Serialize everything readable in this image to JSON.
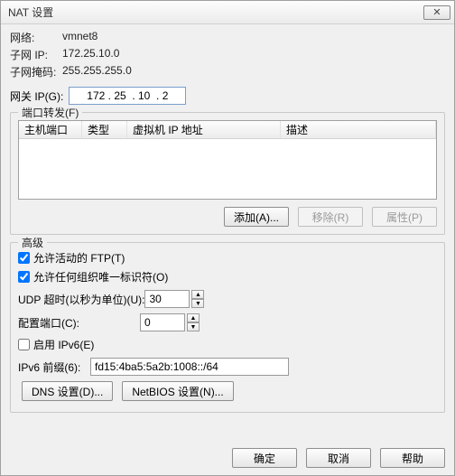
{
  "title": "NAT 设置",
  "info": {
    "network_label": "网络:",
    "network_value": "vmnet8",
    "subnet_ip_label": "子网 IP:",
    "subnet_ip_value": "172.25.10.0",
    "subnet_mask_label": "子网掩码:",
    "subnet_mask_value": "255.255.255.0"
  },
  "gateway": {
    "label": "网关 IP(G):",
    "value": "172 . 25  . 10  . 2"
  },
  "port_forward": {
    "legend": "端口转发(F)",
    "columns": {
      "host": "主机端口",
      "type": "类型",
      "vmip": "虚拟机 IP 地址",
      "desc": "描述"
    },
    "buttons": {
      "add": "添加(A)...",
      "remove": "移除(R)",
      "properties": "属性(P)"
    }
  },
  "advanced": {
    "legend": "高级",
    "allow_active_ftp_label": "允许活动的 FTP(T)",
    "allow_active_ftp_checked": true,
    "allow_oui_label": "允许任何组织唯一标识符(O)",
    "allow_oui_checked": true,
    "udp_timeout_label": "UDP 超时(以秒为单位)(U):",
    "udp_timeout_value": "30",
    "config_port_label": "配置端口(C):",
    "config_port_value": "0",
    "enable_ipv6_label": "启用 IPv6(E)",
    "enable_ipv6_checked": false,
    "ipv6_prefix_label": "IPv6 前缀(6):",
    "ipv6_prefix_value": "fd15:4ba5:5a2b:1008::/64",
    "dns_button": "DNS 设置(D)...",
    "netbios_button": "NetBIOS 设置(N)..."
  },
  "footer": {
    "ok": "确定",
    "cancel": "取消",
    "help": "帮助"
  }
}
